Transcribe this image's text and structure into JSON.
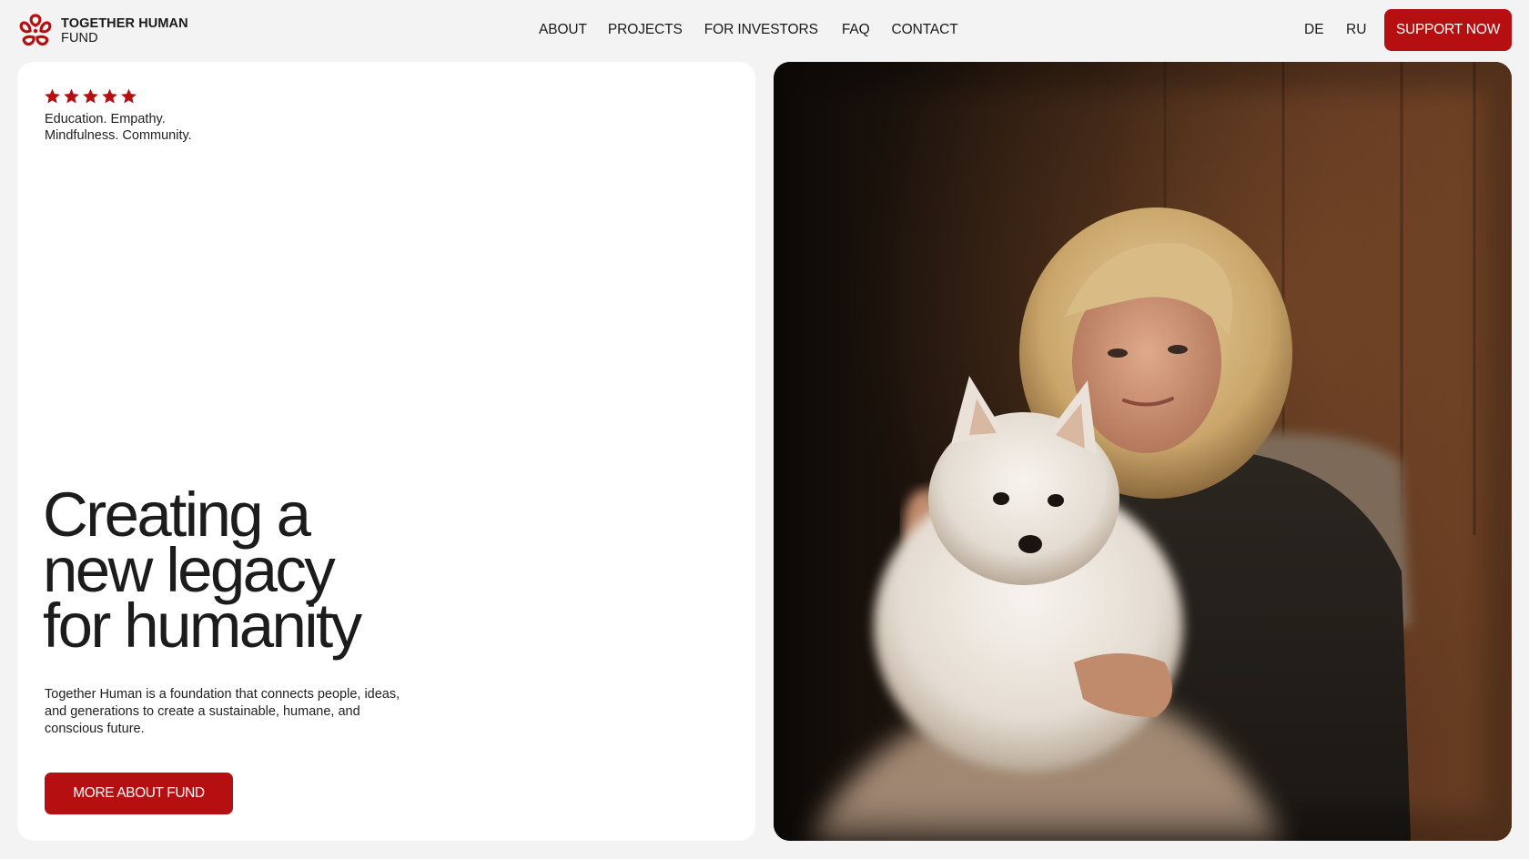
{
  "brand": {
    "name_line1": "TOGETHER HUMAN",
    "name_line2": "FUND",
    "accent_color": "#b50f12",
    "logo_icon": "flower-knot-logo-icon"
  },
  "nav": {
    "items": [
      {
        "label": "ABOUT"
      },
      {
        "label": "PROJECTS"
      },
      {
        "label": "FOR INVESTORS"
      },
      {
        "label": "FAQ"
      },
      {
        "label": "CONTACT"
      }
    ]
  },
  "languages": [
    "DE",
    "RU"
  ],
  "header": {
    "support_label": "SUPPORT NOW"
  },
  "hero": {
    "rating_stars": 5,
    "star_icon": "star-icon",
    "tagline_line1": "Education. Empathy.",
    "tagline_line2": "Mindfulness. Community.",
    "headline_line1": "Creating a",
    "headline_line2": "new legacy",
    "headline_line3": "for humanity",
    "description": "Together Human is a foundation that connects people, ideas, and generations to create a sustainable, humane, and conscious future.",
    "cta_label": "MORE ABOUT FUND"
  },
  "photo": {
    "subject": "woman holding a white pomeranian dog"
  }
}
